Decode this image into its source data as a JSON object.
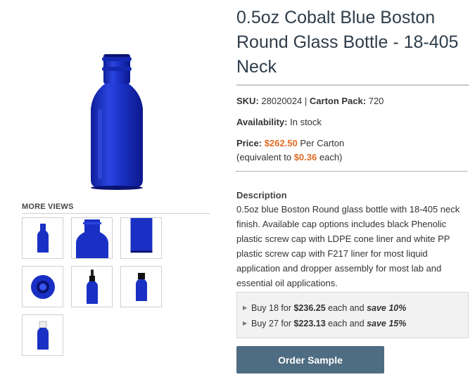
{
  "product": {
    "title": "0.5oz Cobalt Blue Boston Round Glass Bottle - 18-405 Neck",
    "sku_label": "SKU:",
    "sku_value": "28020024",
    "separator": "|",
    "carton_label": "Carton Pack:",
    "carton_value": "720",
    "availability_label": "Availability:",
    "availability_value": "In stock",
    "price_label": "Price:",
    "price_value": "$262.50",
    "price_unit": "Per Carton",
    "equiv_prefix": "(equivalent to",
    "equiv_value": "$0.36",
    "equiv_suffix": "each)",
    "description_title": "Description",
    "description_text": "0.5oz blue Boston Round glass bottle with 18-405 neck finish. Available cap options includes black Phenolic plastic screw cap with LDPE cone liner and white PP plastic screw cap with F217 liner for most liquid application and dropper assembly for most lab and essential oil applications."
  },
  "more_views": {
    "title": "MORE VIEWS",
    "thumbnails": [
      "bottle-front-view",
      "bottle-neck-closeup",
      "bottle-body-closeup",
      "bottle-top-view",
      "bottle-with-dropper",
      "bottle-with-black-cap",
      "bottle-with-white-cap"
    ]
  },
  "tiers": [
    {
      "prefix": "Buy 18 for",
      "price": "$236.25",
      "mid": "each and",
      "save": "save 10%"
    },
    {
      "prefix": "Buy 27 for",
      "price": "$223.13",
      "mid": "each and",
      "save": "save 15%"
    }
  ],
  "order_button_label": "Order Sample",
  "colors": {
    "cobalt": "#1a2fb8",
    "accent_orange": "#e36c24",
    "button": "#4f6d82",
    "title": "#2f3d4a"
  }
}
